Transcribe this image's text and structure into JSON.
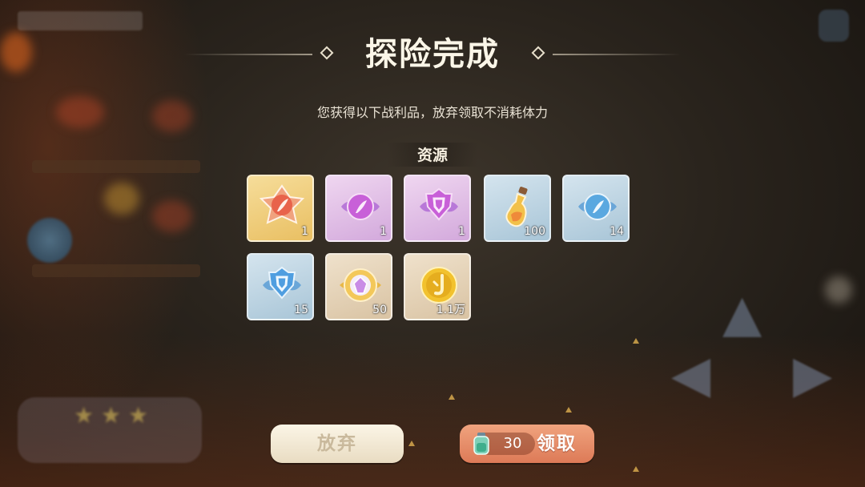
{
  "title": "探险完成",
  "subtitle": "您获得以下战利品，放弃领取不消耗体力",
  "section_label": "资源",
  "items": [
    {
      "name": "orange-crystal-feather",
      "count": "1",
      "rarity": "gold"
    },
    {
      "name": "purple-crystal-feather",
      "count": "1",
      "rarity": "purple"
    },
    {
      "name": "purple-crystal-shield",
      "count": "1",
      "rarity": "purple"
    },
    {
      "name": "potion-bottle",
      "count": "100",
      "rarity": "blue"
    },
    {
      "name": "blue-crystal-feather",
      "count": "14",
      "rarity": "blue"
    },
    {
      "name": "blue-crystal-shield",
      "count": "15",
      "rarity": "blue"
    },
    {
      "name": "gem-badge",
      "count": "50",
      "rarity": "beige"
    },
    {
      "name": "gold-coin",
      "count": "1.1万",
      "rarity": "beige"
    }
  ],
  "buttons": {
    "abandon_label": "放弃",
    "claim_label": "领取",
    "claim_cost": "30"
  },
  "colors": {
    "gold_tile": "#e9bf62",
    "purple_tile": "#d3a9dc",
    "blue_tile": "#a8c5d7",
    "beige_tile": "#d9c3a3",
    "claim_button": "#dd7a57",
    "abandon_button": "#f5ecd8"
  }
}
